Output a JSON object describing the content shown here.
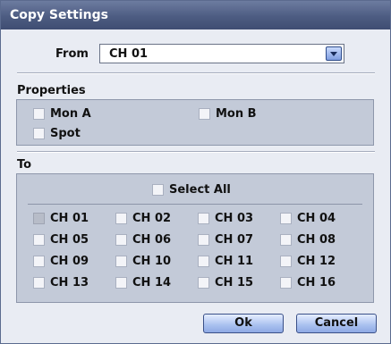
{
  "dialog": {
    "title": "Copy Settings"
  },
  "from": {
    "label": "From",
    "value": "CH 01"
  },
  "properties": {
    "label": "Properties",
    "items": [
      {
        "label": "Mon A",
        "checked": false
      },
      {
        "label": "Mon B",
        "checked": false
      },
      {
        "label": "Spot",
        "checked": false
      }
    ]
  },
  "to": {
    "label": "To",
    "select_all": "Select All",
    "channels": [
      "CH 01",
      "CH 02",
      "CH 03",
      "CH 04",
      "CH 05",
      "CH 06",
      "CH 07",
      "CH 08",
      "CH 09",
      "CH 10",
      "CH 11",
      "CH 12",
      "CH 13",
      "CH 14",
      "CH 15",
      "CH 16"
    ]
  },
  "buttons": {
    "ok": "Ok",
    "cancel": "Cancel"
  }
}
